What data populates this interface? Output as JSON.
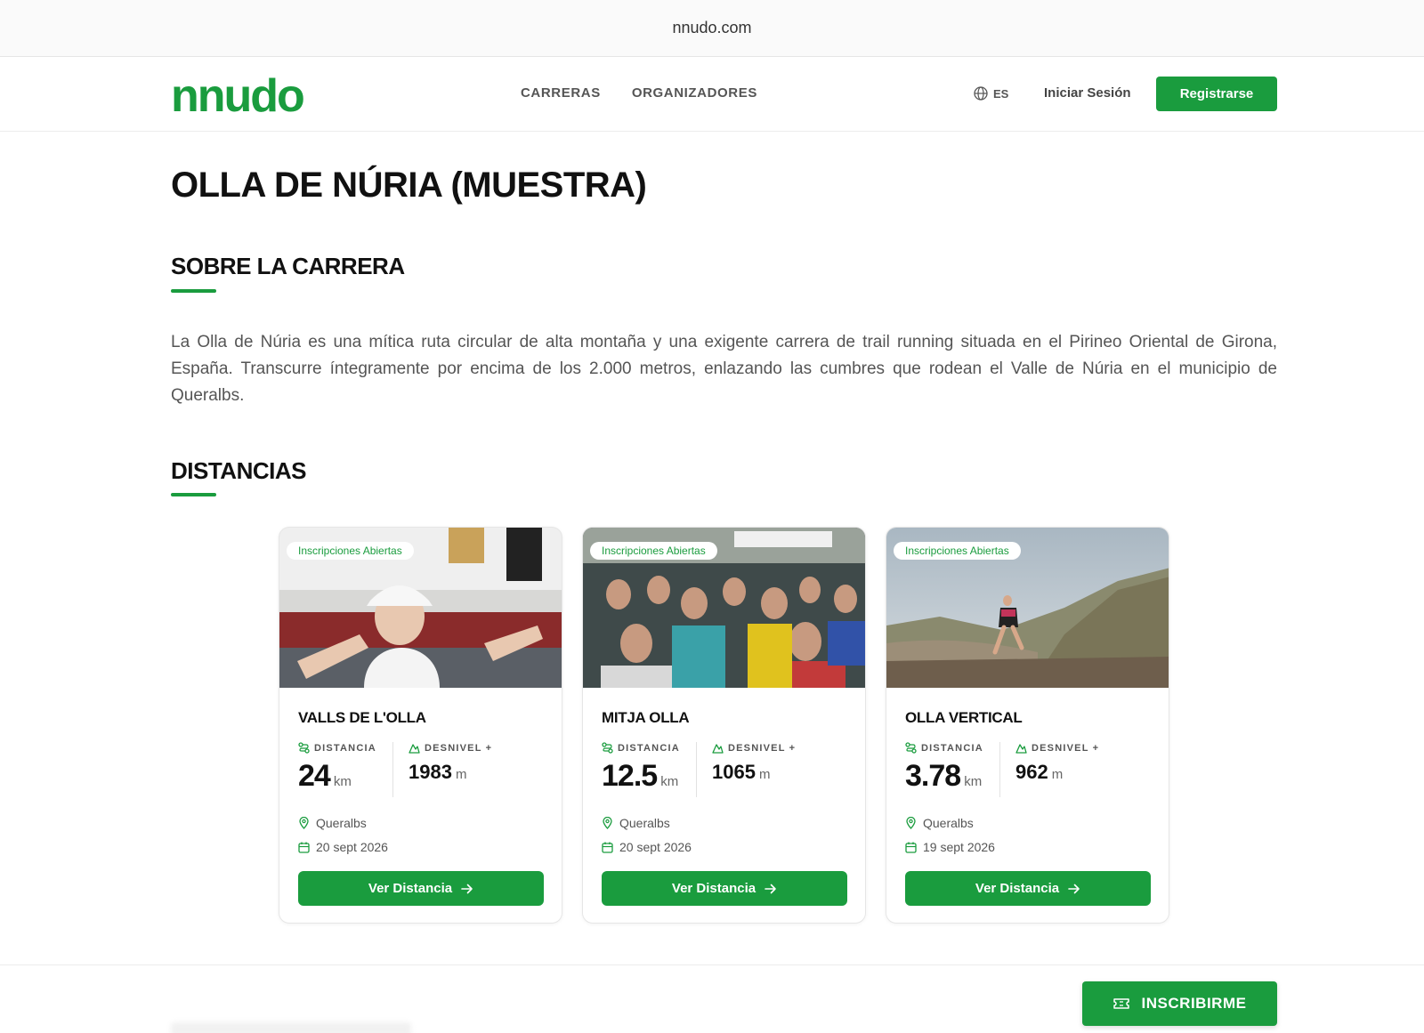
{
  "browser": {
    "url": "nnudo.com"
  },
  "nav": {
    "logo": "nnudo",
    "links": [
      "CARRERAS",
      "ORGANIZADORES"
    ],
    "lang": "ES",
    "login": "Iniciar Sesión",
    "register": "Registrarse"
  },
  "page": {
    "title": "OLLA DE NÚRIA (MUESTRA)",
    "about_title": "SOBRE LA CARRERA",
    "about_text": "La Olla de Núria es una mítica ruta circular de alta montaña y una exigente carrera de trail running situada en el Pirineo Oriental de Girona, España. Transcurre íntegramente por encima de los 2.000 metros, enlazando las cumbres que rodean el Valle de Núria en el municipio de Queralbs.",
    "distances_title": "DISTANCIAS"
  },
  "cards": [
    {
      "badge": "Inscripciones Abiertas",
      "name": "VALLS DE L'OLLA",
      "dist_label": "DISTANCIA",
      "dist": "24",
      "dist_unit": "km",
      "elev_label": "DESNIVEL +",
      "elev": "1983",
      "elev_unit": "m",
      "location": "Queralbs",
      "date": "20 sept 2026",
      "button": "Ver Distancia",
      "image": "runner-finish-photo"
    },
    {
      "badge": "Inscripciones Abiertas",
      "name": "MITJA OLLA",
      "dist_label": "DISTANCIA",
      "dist": "12.5",
      "dist_unit": "km",
      "elev_label": "DESNIVEL +",
      "elev": "1065",
      "elev_unit": "m",
      "location": "Queralbs",
      "date": "20 sept 2026",
      "button": "Ver Distancia",
      "image": "race-start-crowd-photo"
    },
    {
      "badge": "Inscripciones Abiertas",
      "name": "OLLA VERTICAL",
      "dist_label": "DISTANCIA",
      "dist": "3.78",
      "dist_unit": "km",
      "elev_label": "DESNIVEL +",
      "elev": "962",
      "elev_unit": "m",
      "location": "Queralbs",
      "date": "19 sept 2026",
      "button": "Ver Distancia",
      "image": "mountain-runner-photo"
    }
  ],
  "footer": {
    "cta": "INSCRIBIRME"
  },
  "colors": {
    "brand": "#1a9c3e",
    "text": "#111111",
    "muted": "#555555"
  }
}
